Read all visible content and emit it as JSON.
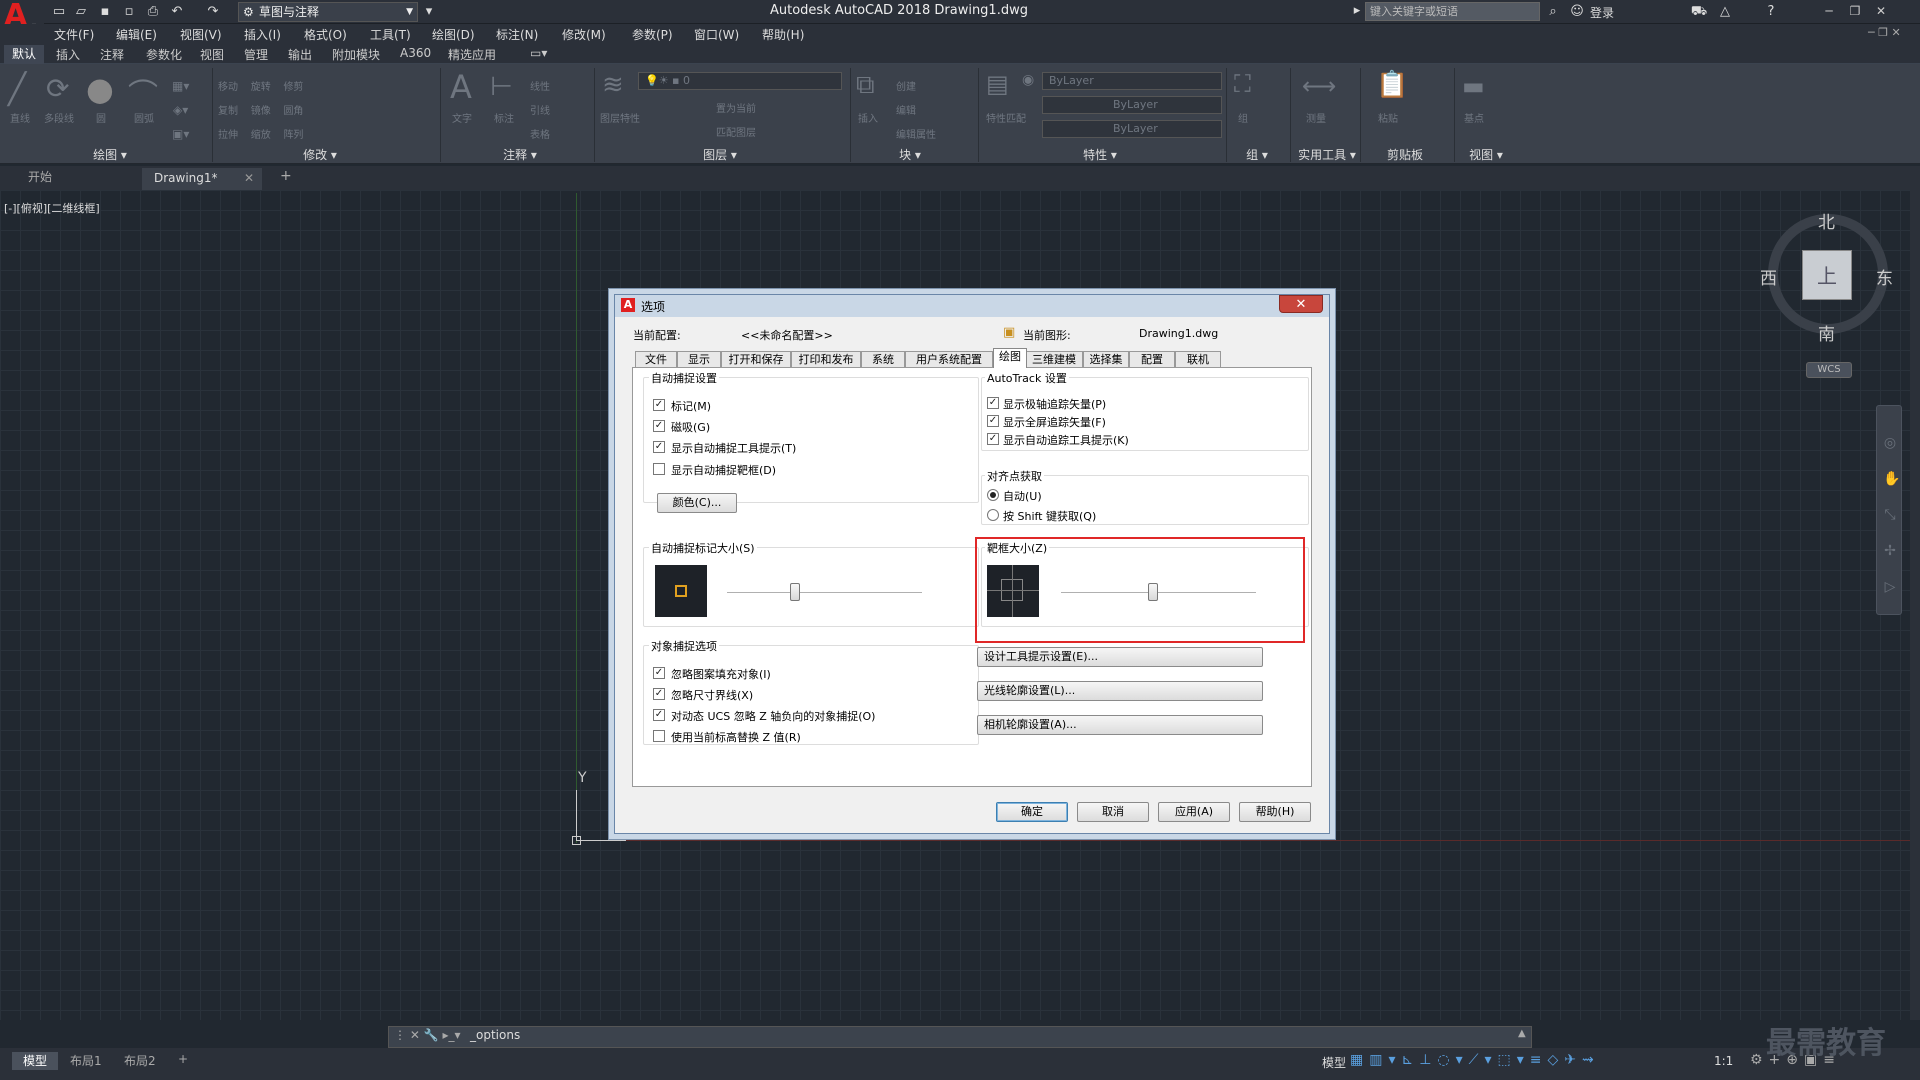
{
  "titlebar": {
    "app_title": "Autodesk AutoCAD 2018    Drawing1.dwg",
    "workspace": "草图与注释",
    "search_placeholder": "键入关键字或短语",
    "login": "登录"
  },
  "menu": [
    "文件(F)",
    "编辑(E)",
    "视图(V)",
    "插入(I)",
    "格式(O)",
    "工具(T)",
    "绘图(D)",
    "标注(N)",
    "修改(M)",
    "参数(P)",
    "窗口(W)",
    "帮助(H)"
  ],
  "ribbon_tabs": [
    "默认",
    "插入",
    "注释",
    "参数化",
    "视图",
    "管理",
    "输出",
    "附加模块",
    "A360",
    "精选应用"
  ],
  "ribbon": {
    "draw_tools": [
      "直线",
      "多段线",
      "圆",
      "圆弧"
    ],
    "modify_tools": [
      "移动",
      "旋转",
      "修剪",
      "复制",
      "镜像",
      "圆角",
      "拉伸",
      "缩放",
      "阵列"
    ],
    "annotation_tools": [
      "文字",
      "标注",
      "线性",
      "引线",
      "表格"
    ],
    "layer_tools": [
      "图层特性",
      "置为当前",
      "匹配图层"
    ],
    "layer_value": "0",
    "block_tools": [
      "插入",
      "创建",
      "编辑",
      "编辑属性"
    ],
    "properties_tools": [
      "特性匹配"
    ],
    "bylayer": [
      "ByLayer",
      "ByLayer",
      "ByLayer"
    ],
    "group_label": "组",
    "util_label": "测量",
    "paste_label": "粘贴",
    "base_label": "基点",
    "panels": [
      "绘图",
      "修改",
      "注释",
      "图层",
      "块",
      "特性",
      "组",
      "实用工具",
      "剪贴板",
      "视图"
    ]
  },
  "doc_tabs": {
    "start": "开始",
    "drawing": "Drawing1*",
    "add": "+"
  },
  "viewport_label": "[-][俯视][二维线框]",
  "viewcube": {
    "north": "北",
    "south": "南",
    "east": "东",
    "west": "西",
    "face": "上",
    "wcs": "WCS"
  },
  "ucs": {
    "y": "Y"
  },
  "dialog": {
    "title": "选项",
    "current_profile_label": "当前配置:",
    "current_profile": "<<未命名配置>>",
    "current_drawing_label": "当前图形:",
    "current_drawing": "Drawing1.dwg",
    "tabs": [
      "文件",
      "显示",
      "打开和保存",
      "打印和发布",
      "系统",
      "用户系统配置",
      "绘图",
      "三维建模",
      "选择集",
      "配置",
      "联机"
    ],
    "active_tab": "绘图",
    "autosnap": {
      "title": "自动捕捉设置",
      "options": [
        {
          "label": "标记(M)",
          "checked": true
        },
        {
          "label": "磁吸(G)",
          "checked": true
        },
        {
          "label": "显示自动捕捉工具提示(T)",
          "checked": true
        },
        {
          "label": "显示自动捕捉靶框(D)",
          "checked": false
        }
      ],
      "color_button": "颜色(C)..."
    },
    "autotrack": {
      "title": "AutoTrack 设置",
      "options": [
        {
          "label": "显示极轴追踪矢量(P)",
          "checked": true
        },
        {
          "label": "显示全屏追踪矢量(F)",
          "checked": true
        },
        {
          "label": "显示自动追踪工具提示(K)",
          "checked": true
        }
      ]
    },
    "alignment": {
      "title": "对齐点获取",
      "options": [
        {
          "label": "自动(U)",
          "selected": true
        },
        {
          "label": "按 Shift 键获取(Q)",
          "selected": false
        }
      ]
    },
    "marker_size": {
      "title": "自动捕捉标记大小(S)",
      "value": 0.35
    },
    "aperture_size": {
      "title": "靶框大小(Z)",
      "value": 0.47
    },
    "object_snap": {
      "title": "对象捕捉选项",
      "options": [
        {
          "label": "忽略图案填充对象(I)",
          "checked": true
        },
        {
          "label": "忽略尺寸界线(X)",
          "checked": true
        },
        {
          "label": "对动态 UCS 忽略 Z 轴负向的对象捕捉(O)",
          "checked": true
        },
        {
          "label": "使用当前标高替换 Z 值(R)",
          "checked": false
        }
      ]
    },
    "side_buttons": [
      "设计工具提示设置(E)...",
      "光线轮廓设置(L)...",
      "相机轮廓设置(A)..."
    ],
    "footer_buttons": [
      "确定",
      "取消",
      "应用(A)",
      "帮助(H)"
    ]
  },
  "command_line": {
    "text": "_options"
  },
  "status": {
    "model_tab": "模型",
    "layouts": [
      "布局1",
      "布局2"
    ],
    "add": "+",
    "model": "模型",
    "scale": "1:1"
  },
  "watermark": "最需教育",
  "colors": {
    "accent": "#e02828",
    "canvas": "#212830",
    "dialog_bg": "#f0f0f0"
  }
}
